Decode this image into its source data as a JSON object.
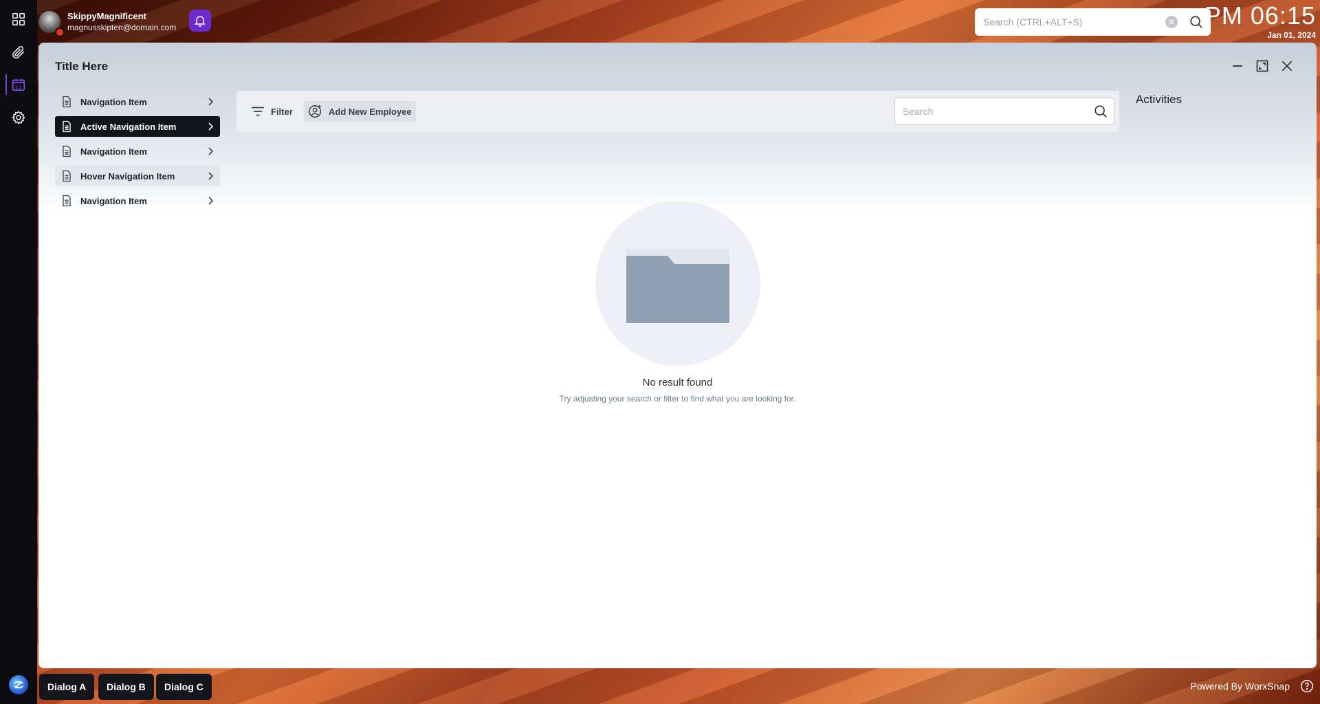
{
  "user": {
    "name": "SkippyMagnificent",
    "email": "magnusskipten@domain.com"
  },
  "top_search": {
    "placeholder": "Search (CTRL+ALT+S)"
  },
  "clock": {
    "time": "PM 06:15",
    "date": "Jan 01, 2024"
  },
  "window": {
    "title": "Title Here"
  },
  "nav": {
    "items": [
      {
        "label": "Navigation Item",
        "state": "default"
      },
      {
        "label": "Active Navigation Item",
        "state": "active"
      },
      {
        "label": "Navigation Item",
        "state": "default"
      },
      {
        "label": "Hover Navigation Item",
        "state": "hover"
      },
      {
        "label": "Navigation Item",
        "state": "default"
      }
    ]
  },
  "toolbar": {
    "filter_label": "Filter",
    "add_label": "Add New Employee",
    "search_placeholder": "Search"
  },
  "activities": {
    "title": "Activities"
  },
  "empty_state": {
    "title": "No result found",
    "subtitle": "Try adjusting your search or filter to find what you are looking for."
  },
  "taskbar": {
    "dialogs": [
      "Dialog A",
      "Dialog B",
      "Dialog C"
    ],
    "powered_by": "Powered By WorxSnap"
  },
  "colors": {
    "accent": "#6b2bd0",
    "active_nav_bg": "#111418",
    "status_dot": "#e5351f",
    "folder": "#8fa0b3"
  },
  "icons": {
    "rail": [
      "grid-icon",
      "paperclip-icon",
      "calendar-icon",
      "gear-icon"
    ],
    "calendar_day": "12"
  }
}
